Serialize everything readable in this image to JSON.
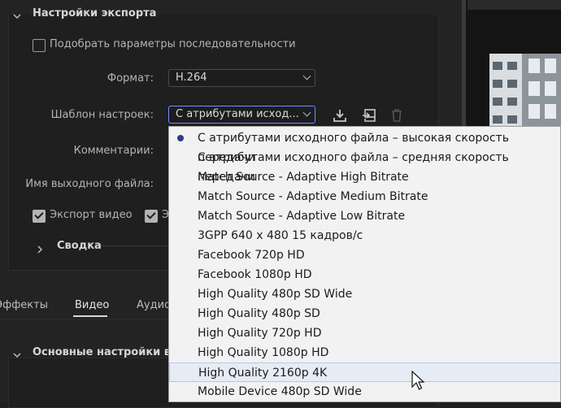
{
  "export_settings": {
    "section_title": "Настройки экспорта",
    "match_sequence_label": "Подобрать параметры последовательности",
    "match_sequence_checked": false,
    "format_label": "Формат:",
    "format_value": "H.264",
    "preset_label": "Шаблон настроек:",
    "preset_value": "С атрибутами исход...",
    "comments_label": "Комментарии:",
    "output_name_label": "Имя выходного файла:",
    "export_video_label": "Экспорт видео",
    "export_video_checked": true,
    "export_audio_partial": "Э",
    "export_audio_checked": true,
    "summary_label": "Сводка"
  },
  "tabs": [
    {
      "label": "Эффекты"
    },
    {
      "label": "Видео",
      "active": true
    },
    {
      "label": "Аудио"
    }
  ],
  "video_section_title": "Основные настройки вид",
  "preset_dropdown": {
    "items": [
      {
        "label": "С атрибутами исходного файла – высокая скорость передачи",
        "selected": true
      },
      {
        "label": "С атрибутами исходного файла – средняя скорость передачи"
      },
      {
        "label": "Match Source - Adaptive High Bitrate"
      },
      {
        "label": "Match Source - Adaptive Medium Bitrate"
      },
      {
        "label": "Match Source - Adaptive Low Bitrate"
      },
      {
        "label": "3GPP 640 x 480 15 кадров/с"
      },
      {
        "label": "Facebook 720p HD"
      },
      {
        "label": "Facebook 1080p HD"
      },
      {
        "label": "High Quality 480p SD Wide"
      },
      {
        "label": "High Quality 480p SD"
      },
      {
        "label": "High Quality 720p HD"
      },
      {
        "label": "High Quality 1080p HD"
      },
      {
        "label": "High Quality 2160p 4K",
        "hovered": true
      },
      {
        "label": "Mobile Device 480p SD Wide"
      }
    ]
  },
  "icons": [
    "chevron-down-icon",
    "save-preset-icon",
    "import-preset-icon",
    "delete-preset-icon",
    "chevron-right-icon",
    "radio-selected-icon",
    "mouse-pointer-icon"
  ],
  "colors": {
    "panel_bg": "#232323",
    "dropdown_bg": "#f2f2f2",
    "hover_bg": "#e6ecf6",
    "radio_dot": "#2f3a8a",
    "active_border": "#7a8cff"
  }
}
